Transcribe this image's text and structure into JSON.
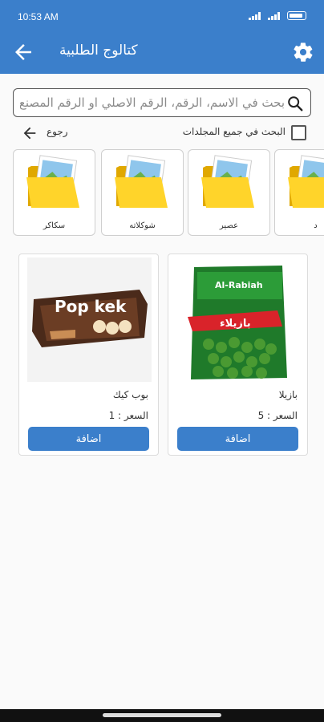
{
  "status_bar": {
    "time": "10:53 AM",
    "battery": "100"
  },
  "header": {
    "title": "كتالوج الطلبية"
  },
  "search": {
    "placeholder": "بحث في الاسم، الرقم، الرقم الاصلي او الرقم المصنع"
  },
  "options": {
    "back_label": "رجوع",
    "search_all_label": "البحث في جميع المجلدات",
    "search_all_checked": false
  },
  "folders": [
    {
      "name": "سكاكر"
    },
    {
      "name": "شوكلاته"
    },
    {
      "name": "عصير"
    },
    {
      "name": "د"
    }
  ],
  "products": [
    {
      "name": "بازيلا",
      "price": "السعر : 5",
      "add_label": "اضافة",
      "image": "green-peas-bag",
      "brand_text": "Al-Rabiah",
      "image_label": "بازيلاء"
    },
    {
      "name": "بوب كيك",
      "price": "السعر : 1",
      "add_label": "اضافة",
      "image": "pop-kek-cake-pack",
      "brand_text": "Pop kek"
    }
  ]
}
